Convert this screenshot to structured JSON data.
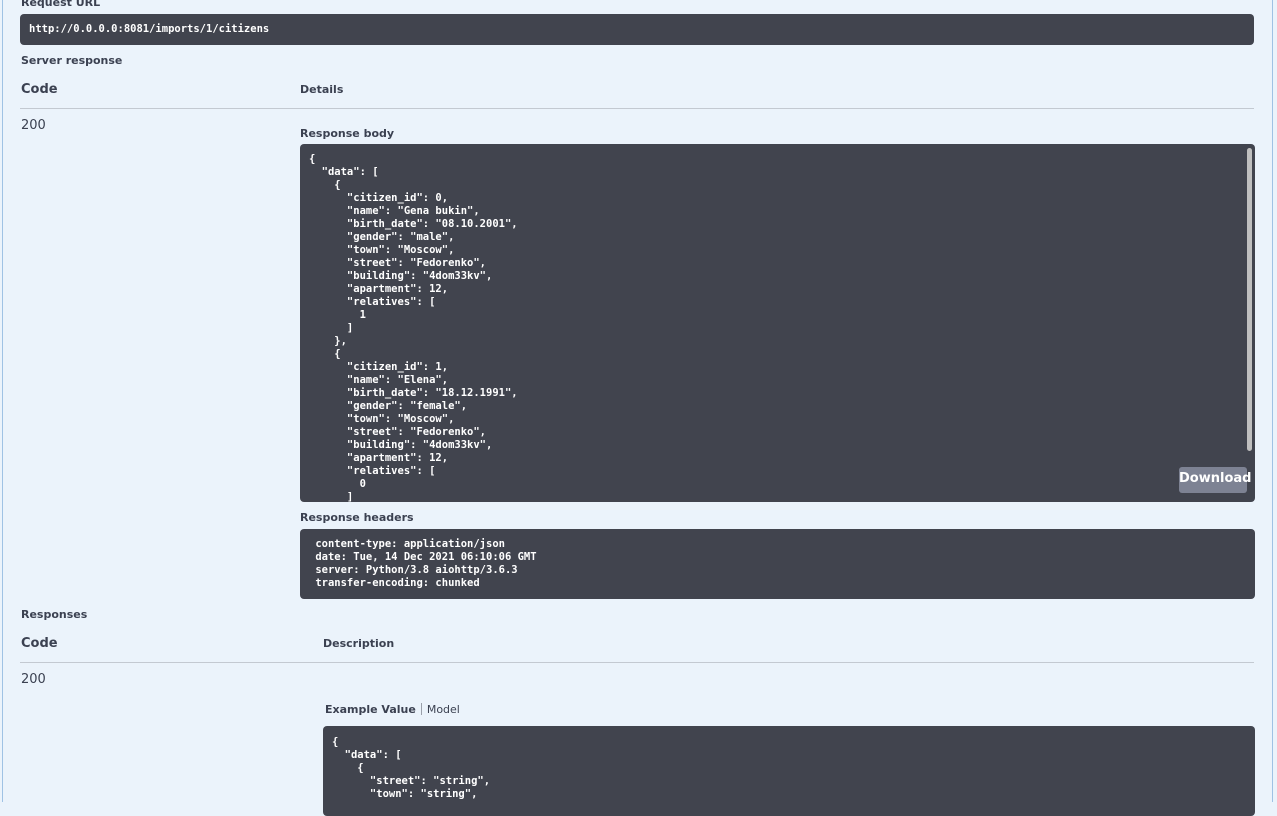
{
  "request_url": {
    "label": "Request URL",
    "value": "http://0.0.0.0:8081/imports/1/citizens"
  },
  "server_response": {
    "label": "Server response",
    "col_code": "Code",
    "col_details": "Details",
    "status_code": "200",
    "response_body_label": "Response body",
    "response_body": "{\n  \"data\": [\n    {\n      \"citizen_id\": 0,\n      \"name\": \"Gena bukin\",\n      \"birth_date\": \"08.10.2001\",\n      \"gender\": \"male\",\n      \"town\": \"Moscow\",\n      \"street\": \"Fedorenko\",\n      \"building\": \"4dom33kv\",\n      \"apartment\": 12,\n      \"relatives\": [\n        1\n      ]\n    },\n    {\n      \"citizen_id\": 1,\n      \"name\": \"Elena\",\n      \"birth_date\": \"18.12.1991\",\n      \"gender\": \"female\",\n      \"town\": \"Moscow\",\n      \"street\": \"Fedorenko\",\n      \"building\": \"4dom33kv\",\n      \"apartment\": 12,\n      \"relatives\": [\n        0\n      ]",
    "download_label": "Download",
    "response_headers_label": "Response headers",
    "response_headers": " content-type: application/json \n date: Tue, 14 Dec 2021 06:10:06 GMT \n server: Python/3.8 aiohttp/3.6.3 \n transfer-encoding: chunked "
  },
  "responses": {
    "label": "Responses",
    "col_code": "Code",
    "col_description": "Description",
    "status_code": "200",
    "tab_example": "Example Value",
    "tab_model": "Model",
    "example_value": "{\n  \"data\": [\n    {\n      \"street\": \"string\",\n      \"town\": \"string\","
  },
  "colors": {
    "background": "#ebf3fb",
    "code_block": "#41444e",
    "download_button": "#7d8293"
  }
}
